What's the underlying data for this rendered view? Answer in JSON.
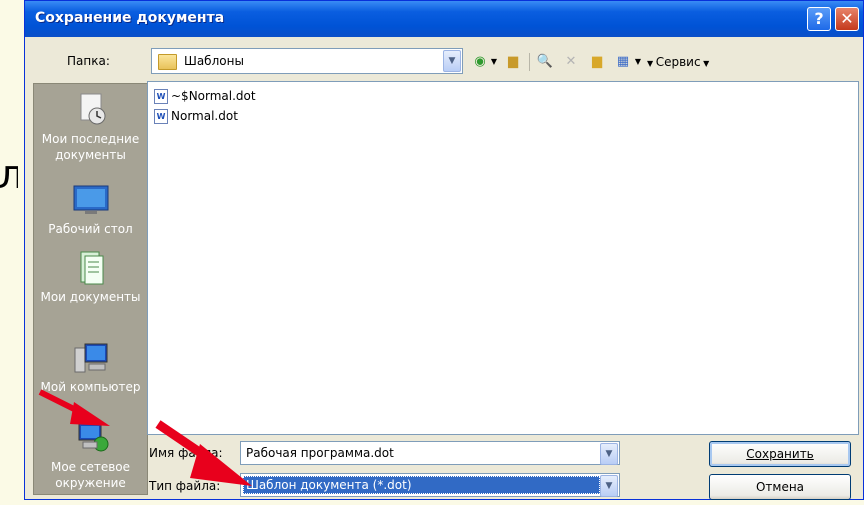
{
  "background": {
    "partial_glyph": "л"
  },
  "dialog": {
    "title": "Сохранение документа",
    "help_label": "?",
    "close_label": "✕"
  },
  "folder": {
    "label": "Папка:",
    "value": "Шаблоны"
  },
  "toolbar": {
    "tools_label": "Сервис"
  },
  "places": [
    {
      "label": "Мои последние документы",
      "icon": "recent-documents-icon"
    },
    {
      "label": "Рабочий стол",
      "icon": "desktop-icon"
    },
    {
      "label": "Мои документы",
      "icon": "my-documents-icon"
    },
    {
      "label": "Мой компьютер",
      "icon": "my-computer-icon"
    },
    {
      "label": "Мое сетевое окружение",
      "icon": "network-places-icon"
    }
  ],
  "files": [
    {
      "name": "~$Normal.dot",
      "icon": "word-template-icon"
    },
    {
      "name": "Normal.dot",
      "icon": "word-template-icon"
    }
  ],
  "filename": {
    "label": "Имя файла:",
    "value": "Рабочая программа.dot"
  },
  "filetype": {
    "label": "Тип файла:",
    "value": "Шаблон документа (*.dot)"
  },
  "buttons": {
    "save": "Сохранить",
    "cancel": "Отмена"
  },
  "colors": {
    "titlebar": "#0053d6",
    "selection": "#316ac5",
    "arrow": "#e8001c",
    "page_background": "#fbfae6"
  }
}
